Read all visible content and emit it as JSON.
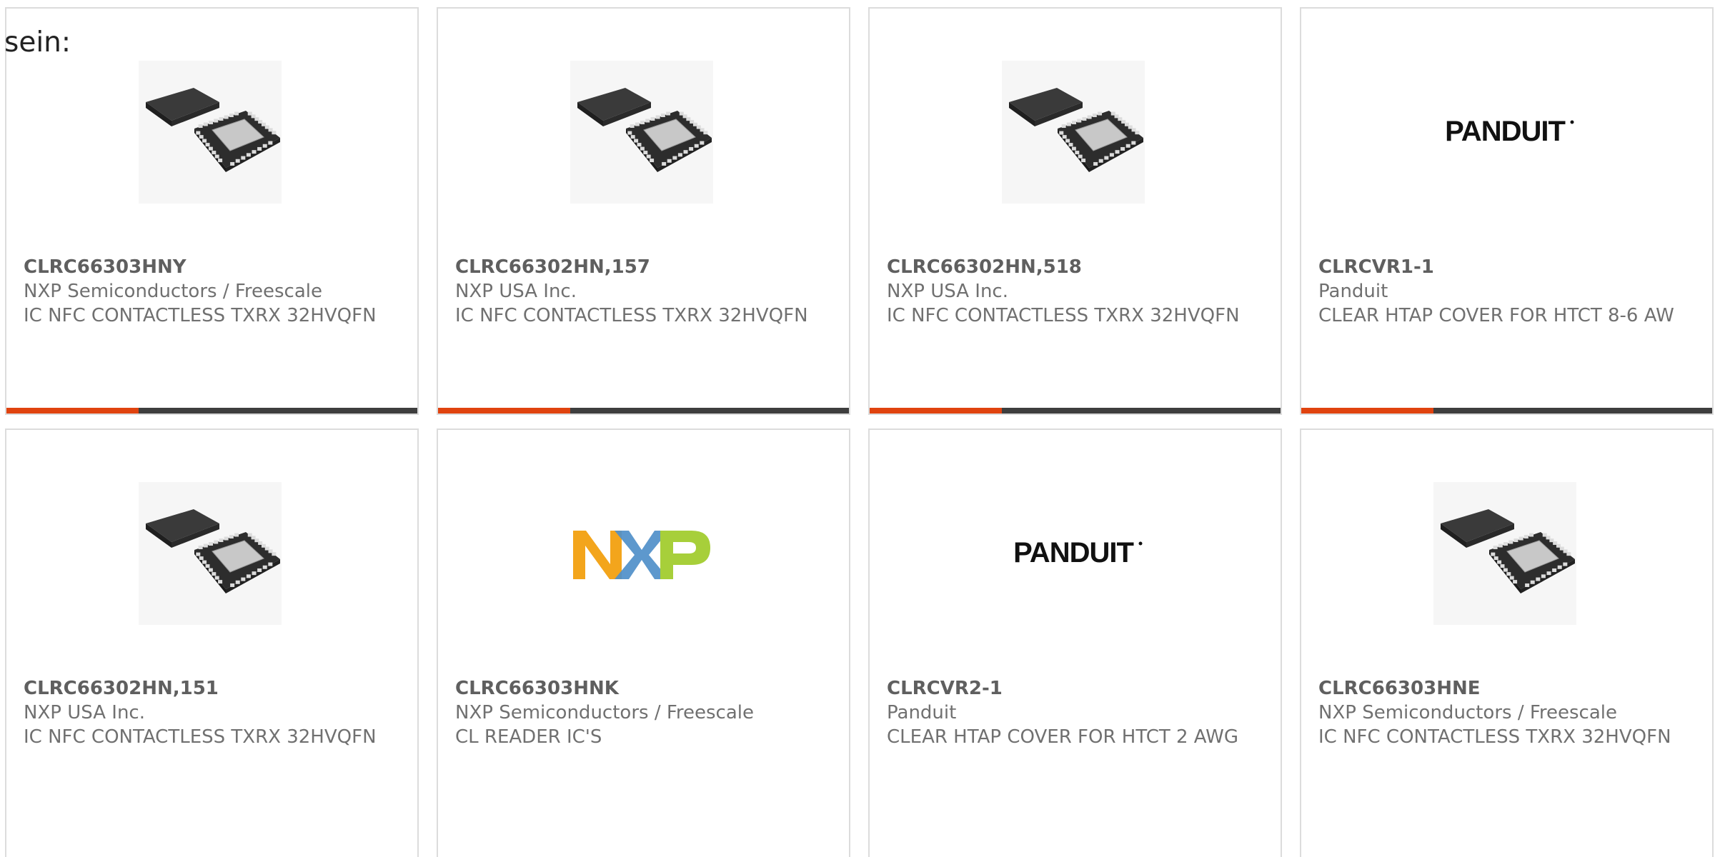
{
  "intro_text": "sein:",
  "colors": {
    "accent": "#e0430f",
    "dark": "#3e3e3e",
    "border": "#dcdcdc",
    "nxp_orange": "#f3a51c",
    "nxp_blue": "#4f8fc9",
    "nxp_green": "#a7cf3a"
  },
  "products": [
    {
      "part": "CLRC66303HNY",
      "manufacturer": "NXP Semiconductors / Freescale",
      "description": "IC NFC CONTACTLESS TXRX 32HVQFN",
      "image": "qfn-chip-icon"
    },
    {
      "part": "CLRC66302HN,157",
      "manufacturer": "NXP USA Inc.",
      "description": "IC NFC CONTACTLESS TXRX 32HVQFN",
      "image": "qfn-chip-icon"
    },
    {
      "part": "CLRC66302HN,518",
      "manufacturer": "NXP USA Inc.",
      "description": "IC NFC CONTACTLESS TXRX 32HVQFN",
      "image": "qfn-chip-icon"
    },
    {
      "part": "CLRCVR1-1",
      "manufacturer": "Panduit",
      "description": "CLEAR HTAP COVER FOR HTCT 8-6 AW",
      "image": "panduit-logo",
      "logo_text": "PANDUIT"
    },
    {
      "part": "CLRC66302HN,151",
      "manufacturer": "NXP USA Inc.",
      "description": "IC NFC CONTACTLESS TXRX 32HVQFN",
      "image": "qfn-chip-icon"
    },
    {
      "part": "CLRC66303HNK",
      "manufacturer": "NXP Semiconductors / Freescale",
      "description": "CL READER IC'S",
      "image": "nxp-logo",
      "logo_text": "NXP"
    },
    {
      "part": "CLRCVR2-1",
      "manufacturer": "Panduit",
      "description": "CLEAR HTAP COVER FOR HTCT 2 AWG",
      "image": "panduit-logo",
      "logo_text": "PANDUIT"
    },
    {
      "part": "CLRC66303HNE",
      "manufacturer": "NXP Semiconductors / Freescale",
      "description": "IC NFC CONTACTLESS TXRX 32HVQFN",
      "image": "qfn-chip-icon"
    }
  ]
}
